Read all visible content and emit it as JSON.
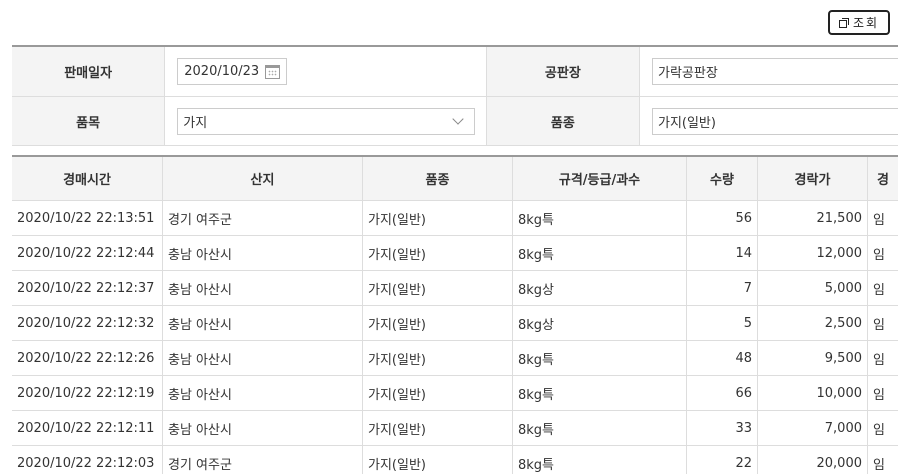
{
  "toolbar": {
    "search_label": "조회"
  },
  "filter": {
    "sale_date_label": "판매일자",
    "sale_date_value": "2020/10/23",
    "market_label": "공판장",
    "market_value": "가락공판장",
    "item_label": "품목",
    "item_value": "가지",
    "variety_label": "품종",
    "variety_value": "가지(일반)"
  },
  "table": {
    "headers": [
      "경매시간",
      "산지",
      "품종",
      "규격/등급/과수",
      "수량",
      "경락가",
      "경"
    ],
    "rows": [
      [
        "2020/10/22 22:13:51",
        "경기 여주군",
        "가지(일반)",
        "8kg특",
        "56",
        "21,500",
        "임"
      ],
      [
        "2020/10/22 22:12:44",
        "충남 아산시",
        "가지(일반)",
        "8kg특",
        "14",
        "12,000",
        "임"
      ],
      [
        "2020/10/22 22:12:37",
        "충남 아산시",
        "가지(일반)",
        "8kg상",
        "7",
        "5,000",
        "임"
      ],
      [
        "2020/10/22 22:12:32",
        "충남 아산시",
        "가지(일반)",
        "8kg상",
        "5",
        "2,500",
        "임"
      ],
      [
        "2020/10/22 22:12:26",
        "충남 아산시",
        "가지(일반)",
        "8kg특",
        "48",
        "9,500",
        "임"
      ],
      [
        "2020/10/22 22:12:19",
        "충남 아산시",
        "가지(일반)",
        "8kg특",
        "66",
        "10,000",
        "임"
      ],
      [
        "2020/10/22 22:12:11",
        "충남 아산시",
        "가지(일반)",
        "8kg특",
        "33",
        "7,000",
        "임"
      ],
      [
        "2020/10/22 22:12:03",
        "경기 여주군",
        "가지(일반)",
        "8kg특",
        "22",
        "20,000",
        "임"
      ]
    ]
  }
}
